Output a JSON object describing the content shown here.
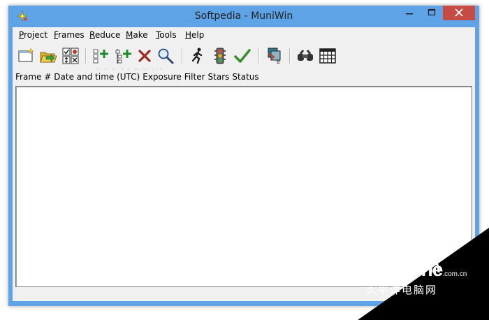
{
  "window": {
    "title": "Softpedia - MuniWin",
    "app_icon": "sparkle-star-icon",
    "controls": [
      "minimize-icon",
      "maximize-icon",
      "close-icon"
    ]
  },
  "menubar": {
    "items": [
      {
        "accel": "P",
        "rest": "roject"
      },
      {
        "accel": "F",
        "rest": "rames"
      },
      {
        "accel": "R",
        "rest": "educe"
      },
      {
        "accel": "M",
        "rest": "ake"
      },
      {
        "accel": "T",
        "rest": "ools"
      },
      {
        "accel": "H",
        "rest": "elp"
      }
    ]
  },
  "toolbar": {
    "buttons": [
      "new-project-icon",
      "open-project-icon",
      "project-settings-icon",
      "add-frames-icon",
      "add-individual-frames-icon",
      "remove-frames-icon",
      "show-frame-icon",
      "express-reduction-icon",
      "traffic-light-icon",
      "checkmark-icon",
      "make-catalog-icon",
      "find-variable-icon",
      "calendar-table-icon"
    ]
  },
  "list": {
    "columns": [
      "Frame #",
      "Date and time (UTC)",
      "Exposure",
      "Filter",
      "Stars",
      "Status"
    ]
  },
  "watermark": {
    "text": "SOFTPEDIA",
    "badge_brand": "PConline",
    "badge_suffix": ".com.cn",
    "badge_chinese": "太平洋电脑网"
  },
  "colors": {
    "title_bar": "#5da3e6",
    "close_button": "#c74a44",
    "client_background": "#f0f0f0"
  }
}
